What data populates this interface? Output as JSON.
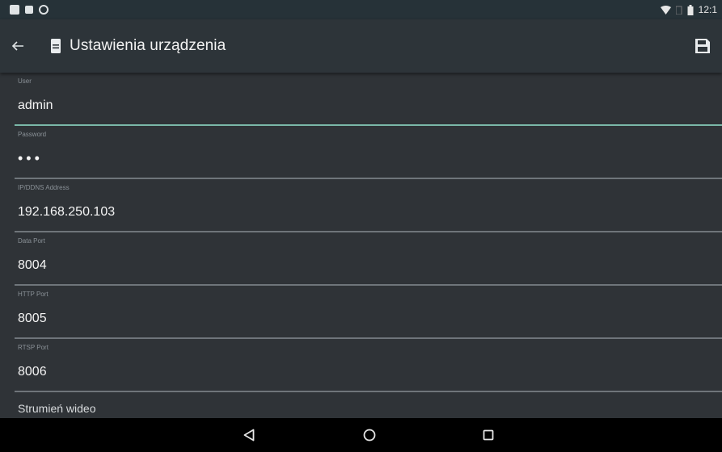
{
  "status_bar": {
    "time": "12:1",
    "icons": [
      "gallery-icon",
      "notification-icon",
      "sync-icon",
      "wifi-icon",
      "signal-icon",
      "battery-icon"
    ]
  },
  "app_bar": {
    "title": "Ustawienia urządzenia",
    "back_icon": "arrow-back-icon",
    "title_icon": "device-icon",
    "save_icon": "save-icon"
  },
  "fields": [
    {
      "label": "User",
      "value": "admin"
    },
    {
      "label": "Password",
      "value": "•••"
    },
    {
      "label": "IP/DDNS Address",
      "value": "192.168.250.103"
    },
    {
      "label": "Data Port",
      "value": "8004"
    },
    {
      "label": "HTTP Port",
      "value": "8005"
    },
    {
      "label": "RTSP Port",
      "value": "8006"
    }
  ],
  "section": {
    "label": "Strumień wideo"
  },
  "nav_bar": {
    "icons": [
      "back-triangle-icon",
      "home-circle-icon",
      "recents-square-icon"
    ]
  },
  "colors": {
    "app_bar": "#2d3439",
    "content_bg": "#2f3337",
    "accent_underline": "#7bb8a8"
  }
}
